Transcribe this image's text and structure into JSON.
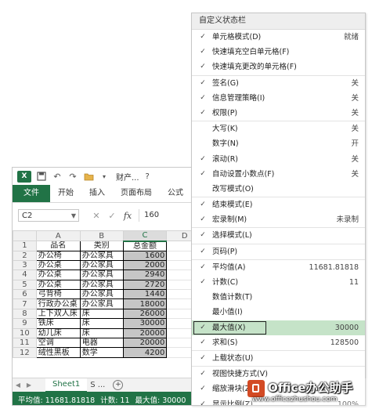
{
  "app": {
    "title": "财产...",
    "help": "?",
    "icons": [
      "excel-logo-icon",
      "save-icon",
      "undo-icon",
      "redo-icon",
      "open-folder-icon"
    ]
  },
  "ribbon": {
    "tabs": [
      "文件",
      "开始",
      "插入",
      "页面布局",
      "公式"
    ]
  },
  "formula_bar": {
    "name_box": "C2",
    "cancel": "✕",
    "enter": "✓",
    "fx": "fx",
    "value": "160"
  },
  "grid": {
    "columns": [
      "A",
      "B",
      "C",
      "D"
    ],
    "selected_column": "C",
    "rows": [
      {
        "n": "1",
        "a": "品名",
        "b": "类别",
        "c": "总金额"
      },
      {
        "n": "2",
        "a": "办公椅",
        "b": "办公家具",
        "c": "1600"
      },
      {
        "n": "3",
        "a": "办公桌",
        "b": "办公家具",
        "c": "2000"
      },
      {
        "n": "4",
        "a": "办公桌",
        "b": "办公家具",
        "c": "2940"
      },
      {
        "n": "5",
        "a": "办公桌",
        "b": "办公家具",
        "c": "2720"
      },
      {
        "n": "6",
        "a": "弓背椅",
        "b": "办公家具",
        "c": "1440"
      },
      {
        "n": "7",
        "a": "行政办公桌",
        "b": "办公家具",
        "c": "18000"
      },
      {
        "n": "8",
        "a": "上下双人床",
        "b": "床",
        "c": "26000"
      },
      {
        "n": "9",
        "a": "铁床",
        "b": "床",
        "c": "30000"
      },
      {
        "n": "10",
        "a": "幼儿床",
        "b": "床",
        "c": "20000"
      },
      {
        "n": "11",
        "a": "空调",
        "b": "电器",
        "c": "20000"
      },
      {
        "n": "12",
        "a": "绒性黑板",
        "b": "数学",
        "c": "4200"
      }
    ]
  },
  "sheets": {
    "prev": "◀",
    "next": "▶",
    "active": "Sheet1",
    "other": "S ...",
    "add": "+"
  },
  "statusbar": {
    "average": "平均值: 11681.81818",
    "count": "计数: 11",
    "max": "最大值: 30000"
  },
  "menu": {
    "title": "自定义状态栏",
    "items": [
      {
        "label": "单元格模式(D)",
        "value": "就绪",
        "checked": true
      },
      {
        "label": "快速填充空白单元格(F)",
        "value": "",
        "checked": true
      },
      {
        "label": "快速填充更改的单元格(F)",
        "value": "",
        "checked": true,
        "sep": true
      },
      {
        "label": "签名(G)",
        "value": "关",
        "checked": true
      },
      {
        "label": "信息管理策略(I)",
        "value": "关",
        "checked": true
      },
      {
        "label": "权限(P)",
        "value": "关",
        "checked": true,
        "sep": true
      },
      {
        "label": "大写(K)",
        "value": "关",
        "checked": false
      },
      {
        "label": "数字(N)",
        "value": "开",
        "checked": false
      },
      {
        "label": "滚动(R)",
        "value": "关",
        "checked": true
      },
      {
        "label": "自动设置小数点(F)",
        "value": "关",
        "checked": true
      },
      {
        "label": "改写模式(O)",
        "value": "",
        "checked": false,
        "sep": true
      },
      {
        "label": "结束模式(E)",
        "value": "",
        "checked": true
      },
      {
        "label": "宏录制(M)",
        "value": "未录制",
        "checked": true,
        "sep": true
      },
      {
        "label": "选择模式(L)",
        "value": "",
        "checked": true,
        "sep": true
      },
      {
        "label": "页码(P)",
        "value": "",
        "checked": true,
        "sep": true
      },
      {
        "label": "平均值(A)",
        "value": "11681.81818",
        "checked": true
      },
      {
        "label": "计数(C)",
        "value": "11",
        "checked": true
      },
      {
        "label": "数值计数(T)",
        "value": "",
        "checked": false
      },
      {
        "label": "最小值(I)",
        "value": "",
        "checked": false
      },
      {
        "label": "最大值(X)",
        "value": "30000",
        "checked": true,
        "highlight": true
      },
      {
        "label": "求和(S)",
        "value": "128500",
        "checked": true,
        "sep": true
      },
      {
        "label": "上载状态(U)",
        "value": "",
        "checked": true,
        "sep": true
      },
      {
        "label": "视图快捷方式(V)",
        "value": "",
        "checked": true
      },
      {
        "label": "缩放滑块(Z)",
        "value": "",
        "checked": true
      },
      {
        "label": "显示比例(Z)",
        "value": "100%",
        "checked": true
      }
    ]
  },
  "watermark": {
    "brand": "Office办公助手",
    "url": "www.officezhushou.com"
  },
  "colors": {
    "excel_green": "#217346",
    "highlight_green": "#c5e3c8",
    "selected_cells": "#c6c6c6",
    "watermark_logo": "#d34a24"
  }
}
